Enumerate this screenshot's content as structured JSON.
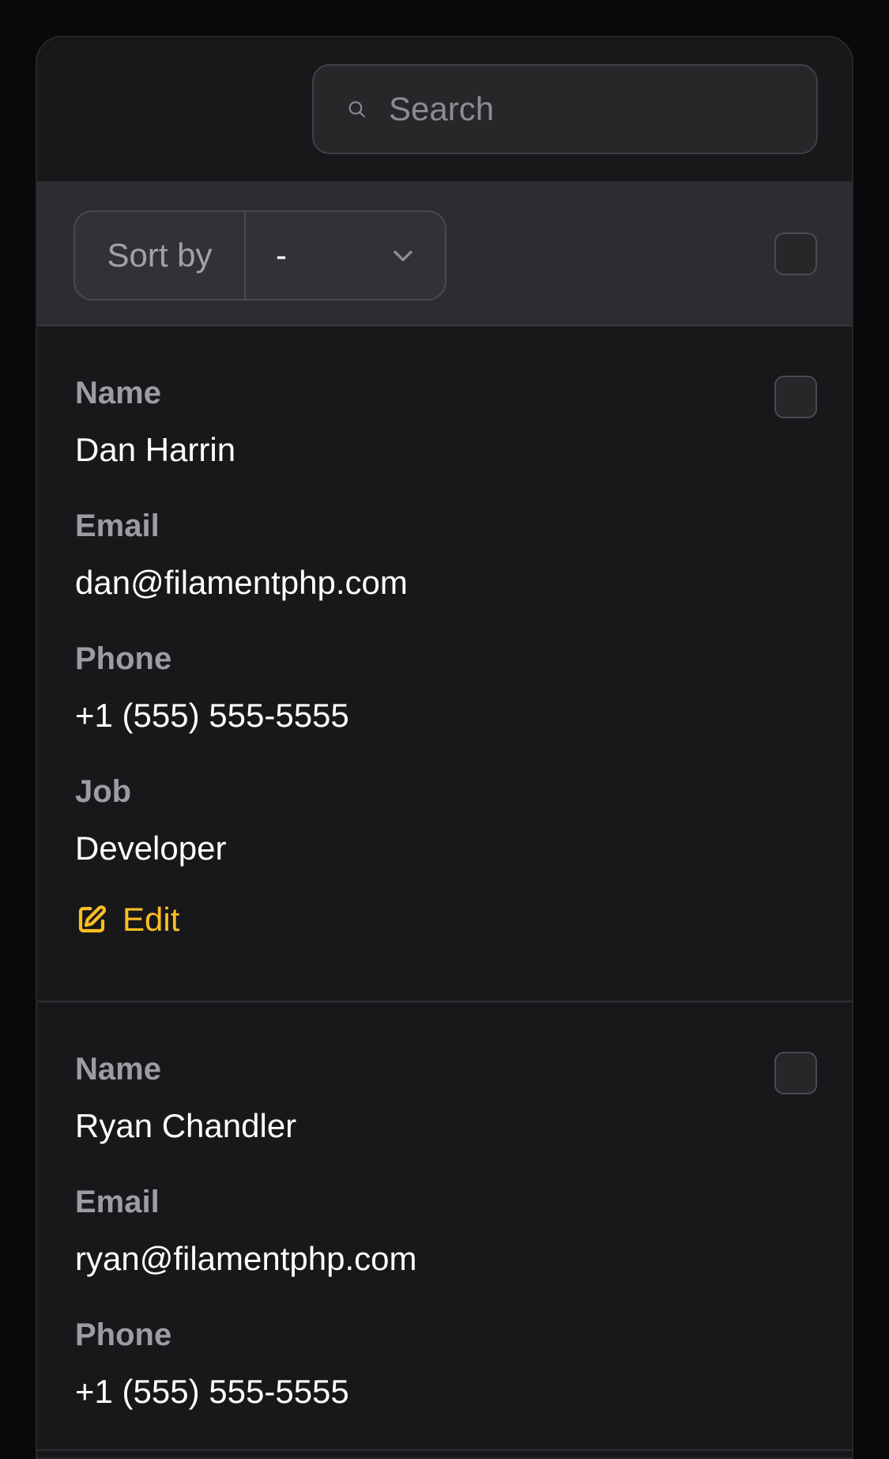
{
  "search": {
    "placeholder": "Search"
  },
  "toolbar": {
    "sort_label": "Sort by",
    "sort_value": "-"
  },
  "records": [
    {
      "name_label": "Name",
      "name": "Dan Harrin",
      "email_label": "Email",
      "email": "dan@filamentphp.com",
      "phone_label": "Phone",
      "phone": "+1 (555) 555-5555",
      "job_label": "Job",
      "job": "Developer",
      "edit_label": "Edit"
    },
    {
      "name_label": "Name",
      "name": "Ryan Chandler",
      "email_label": "Email",
      "email": "ryan@filamentphp.com",
      "phone_label": "Phone",
      "phone": "+1 (555) 555-5555"
    }
  ],
  "colors": {
    "accent": "#fbbf24",
    "background": "#18181b"
  },
  "icons": {
    "search": "search-icon",
    "sort": "chevron-down-icon",
    "edit": "pencil-square-icon"
  }
}
